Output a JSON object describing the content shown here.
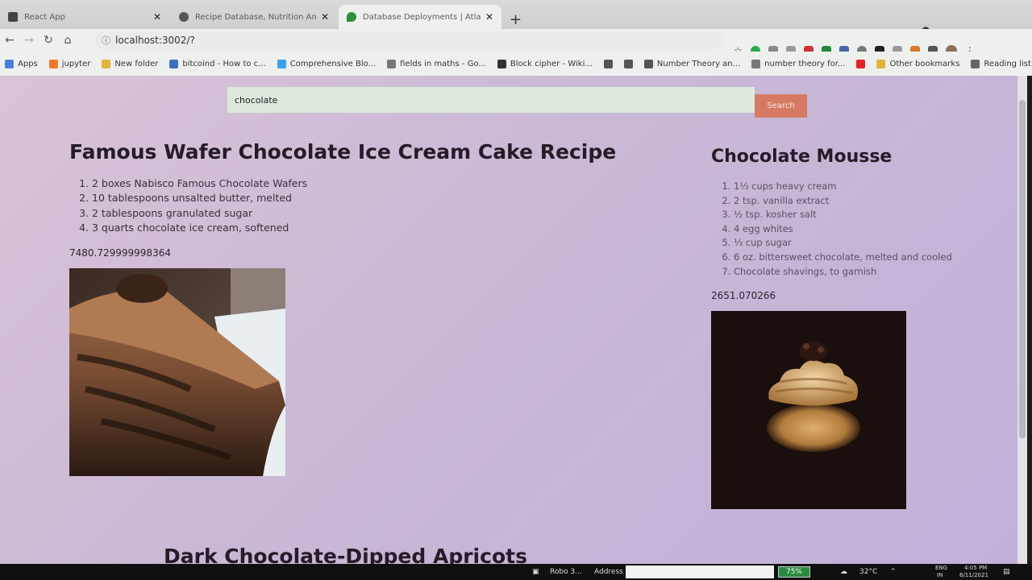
{
  "browser": {
    "tabs": [
      {
        "title": "React App",
        "favicon_color": "#444444",
        "active": false
      },
      {
        "title": "Recipe Database, Nutrition Anal",
        "favicon_color": "#555555",
        "active": false
      },
      {
        "title": "Database Deployments | Atlas: M",
        "favicon_color": "#2f8f3e",
        "active": true
      }
    ],
    "new_tab_label": "+",
    "url": "localhost:3002/?",
    "bookmarks": [
      {
        "label": "Apps",
        "color": "#4a7fd6"
      },
      {
        "label": "jupyter",
        "color": "#f37726"
      },
      {
        "label": "New folder",
        "color": "#e2b33c"
      },
      {
        "label": "bitcoind - How to c...",
        "color": "#3b6fc4"
      },
      {
        "label": "Comprehensive Blo...",
        "color": "#3aa0e8"
      },
      {
        "label": "fields in maths - Go...",
        "color": "#777777"
      },
      {
        "label": "Block cipher - Wiki...",
        "color": "#333333"
      },
      {
        "label": "",
        "color": "#555555"
      },
      {
        "label": "",
        "color": "#555555"
      },
      {
        "label": "Number Theory an...",
        "color": "#555555"
      },
      {
        "label": "number theory for...",
        "color": "#777777"
      },
      {
        "label": "",
        "color": "#e02424"
      },
      {
        "label": "Other bookmarks",
        "color": "#e2b33c"
      },
      {
        "label": "Reading list",
        "color": "#666666"
      }
    ],
    "extension_colors": [
      "#2aa84a",
      "#888888",
      "#999999",
      "#cc3333",
      "#1e8a3c",
      "#4466aa",
      "#777777",
      "#222222",
      "#999999",
      "#d97a2b",
      "#555555",
      "#8a6f5a"
    ]
  },
  "search": {
    "query": "chocolate",
    "button_label": "Search"
  },
  "recipes": [
    {
      "title": "Famous Wafer Chocolate Ice Cream Cake Recipe",
      "ingredients": [
        "2 boxes Nabisco Famous Chocolate Wafers",
        "10 tablespoons unsalted butter, melted",
        "2 tablespoons granulated sugar",
        "3 quarts chocolate ice cream, softened"
      ],
      "score": "7480.729999998364"
    },
    {
      "title": "Chocolate Mousse",
      "ingredients": [
        "1⅓ cups heavy cream",
        "2 tsp. vanilla extract",
        "½ tsp. kosher salt",
        "4 egg whites",
        "⅓ cup sugar",
        "6 oz. bittersweet chocolate, melted and cooled",
        "Chocolate shavings, to garnish"
      ],
      "score": "2651.070266"
    },
    {
      "title": "Dark Chocolate-Dipped Apricots"
    }
  ],
  "taskbar": {
    "items": [
      "Robo 3...",
      "Address"
    ],
    "battery": "75%",
    "temperature": "32°C",
    "language": "ENG",
    "region": "IN",
    "time": "4:05 PM",
    "date": "6/11/2021"
  }
}
